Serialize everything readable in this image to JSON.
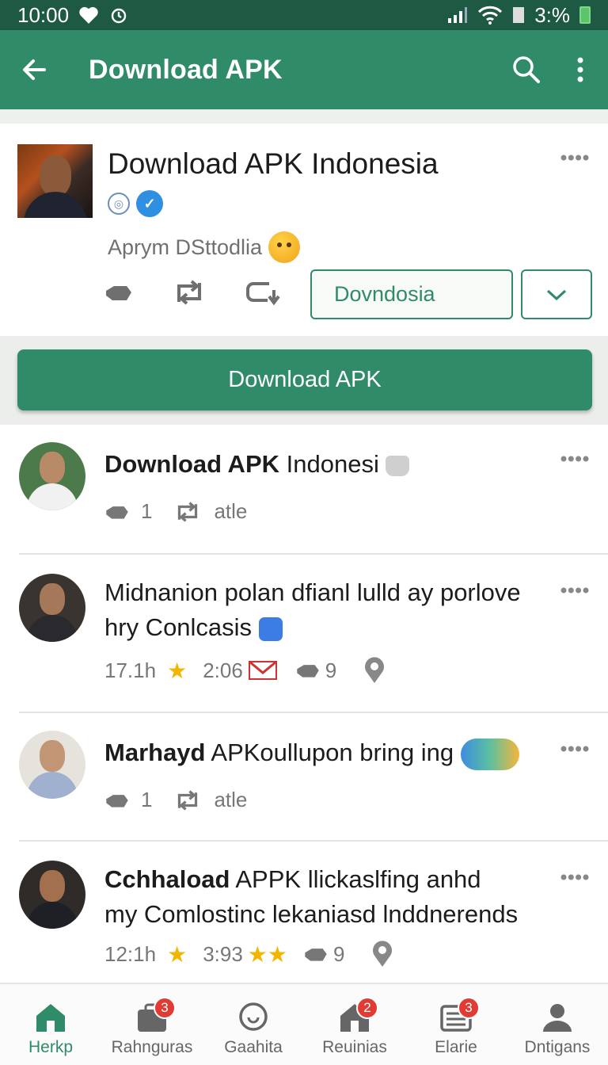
{
  "status_bar": {
    "time": "10:00",
    "battery": "3:%"
  },
  "app_bar": {
    "title": "Download APK"
  },
  "header": {
    "title": "Download APK Indonesia",
    "subtitle": "Aprym DSttodlia",
    "follow_label": "Dovndosia"
  },
  "download_button": {
    "label": "Download APK"
  },
  "posts": [
    {
      "bold": "Download APK",
      "rest": " Indonesi",
      "line2": "",
      "meta": {
        "likes": "1",
        "extra": "atle"
      }
    },
    {
      "bold": "",
      "rest": "Midnanion polan dfianl lulld ay porlove",
      "line2": "hry Conlcasis",
      "meta": {
        "time": "17.1h",
        "time2": "2:06",
        "count": "9"
      }
    },
    {
      "bold": "Marhayd",
      "rest": " APKoullupon bring ing",
      "line2": "",
      "meta": {
        "likes": "1",
        "extra": "atle"
      }
    },
    {
      "bold": "Cchhaload",
      "rest": " APPK llickaslfing anhd",
      "line2": "my Comlostinc lekaniasd lnddnerends",
      "meta": {
        "time": "12:1h",
        "time2": "3:93",
        "count": "9"
      }
    }
  ],
  "bottom_nav": [
    {
      "label": "Herkp",
      "icon": "home-icon",
      "badge": ""
    },
    {
      "label": "Rahnguras",
      "icon": "bag-icon",
      "badge": "3"
    },
    {
      "label": "Gaahita",
      "icon": "chat-icon",
      "badge": ""
    },
    {
      "label": "Reuinias",
      "icon": "house-icon",
      "badge": "2"
    },
    {
      "label": "Elarie",
      "icon": "list-icon",
      "badge": "3"
    },
    {
      "label": "Dntigans",
      "icon": "person-icon",
      "badge": ""
    }
  ],
  "colors": {
    "primary": "#2f8b68",
    "status_bar": "#1e5a43",
    "badge": "#e23b34"
  }
}
